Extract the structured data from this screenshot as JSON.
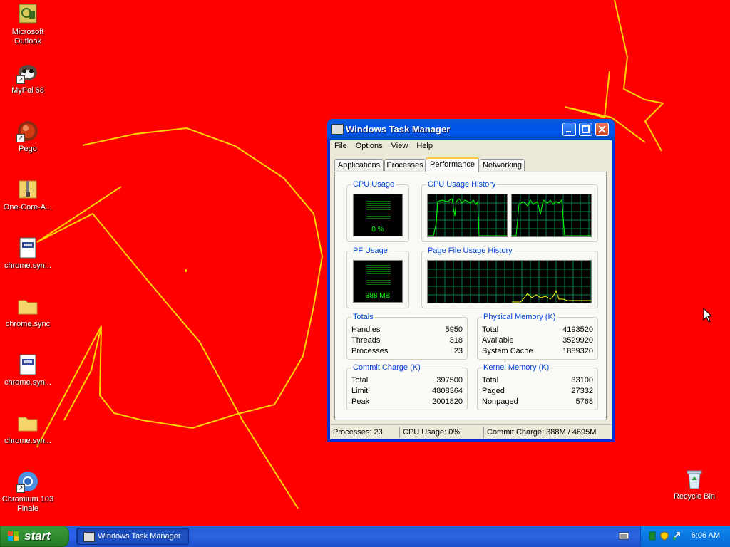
{
  "desktop": {
    "background_color": "#ff0000",
    "icons": [
      {
        "label": "Microsoft\nOutlook",
        "icon": "outlook-icon"
      },
      {
        "label": "MyPal 68",
        "icon": "mypal-icon"
      },
      {
        "label": "Pego",
        "icon": "pego-icon"
      },
      {
        "label": "One-Core-A...",
        "icon": "zip-folder-icon"
      },
      {
        "label": "chrome.syn...",
        "icon": "document-icon"
      },
      {
        "label": "chrome.sync",
        "icon": "folder-icon"
      },
      {
        "label": "chrome.syn...",
        "icon": "document-icon"
      },
      {
        "label": "chrome.syn...",
        "icon": "folder-icon"
      },
      {
        "label": "Chromium 103\nFinale",
        "icon": "chromium-icon"
      },
      {
        "label": "Recycle Bin",
        "icon": "recycle-bin-icon"
      }
    ]
  },
  "window": {
    "title": "Windows Task Manager",
    "menu": [
      "File",
      "Options",
      "View",
      "Help"
    ],
    "tabs": [
      "Applications",
      "Processes",
      "Performance",
      "Networking"
    ],
    "active_tab": "Performance",
    "cpu_usage": {
      "title": "CPU Usage",
      "value": "0 %"
    },
    "cpu_history": {
      "title": "CPU Usage History"
    },
    "pf_usage": {
      "title": "PF Usage",
      "value": "388 MB"
    },
    "pf_history": {
      "title": "Page File Usage History"
    },
    "totals": {
      "title": "Totals",
      "rows": [
        {
          "label": "Handles",
          "value": "5950"
        },
        {
          "label": "Threads",
          "value": "318"
        },
        {
          "label": "Processes",
          "value": "23"
        }
      ]
    },
    "physical_memory": {
      "title": "Physical Memory (K)",
      "rows": [
        {
          "label": "Total",
          "value": "4193520"
        },
        {
          "label": "Available",
          "value": "3529920"
        },
        {
          "label": "System Cache",
          "value": "1889320"
        }
      ]
    },
    "commit_charge": {
      "title": "Commit Charge (K)",
      "rows": [
        {
          "label": "Total",
          "value": "397500"
        },
        {
          "label": "Limit",
          "value": "4808364"
        },
        {
          "label": "Peak",
          "value": "2001820"
        }
      ]
    },
    "kernel_memory": {
      "title": "Kernel Memory (K)",
      "rows": [
        {
          "label": "Total",
          "value": "33100"
        },
        {
          "label": "Paged",
          "value": "27332"
        },
        {
          "label": "Nonpaged",
          "value": "5768"
        }
      ]
    },
    "status": {
      "processes": "Processes: 23",
      "cpu": "CPU Usage: 0%",
      "commit": "Commit Charge: 388M / 4695M"
    }
  },
  "taskbar": {
    "start_label": "start",
    "task_button": "Windows Task Manager",
    "clock": "6:06 AM",
    "accent": "#245edc"
  }
}
